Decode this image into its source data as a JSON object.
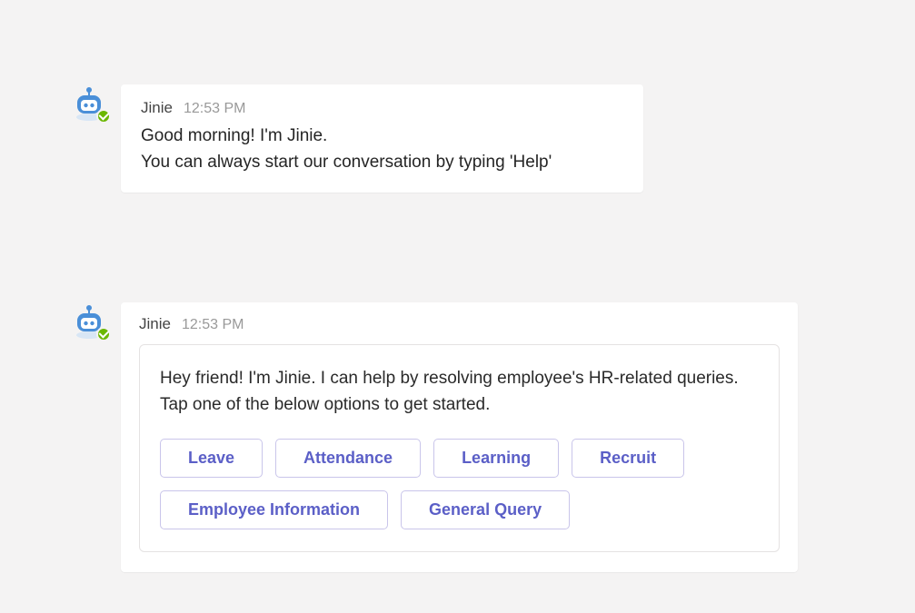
{
  "messages": {
    "m1": {
      "sender": "Jinie",
      "time": "12:53 PM",
      "line1": "Good morning! I'm Jinie.",
      "line2": "You can always start our conversation by typing 'Help'"
    },
    "m2": {
      "sender": "Jinie",
      "time": "12:53 PM",
      "card_text": "Hey friend! I'm Jinie. I can help by resolving employee's HR-related queries. Tap one of the below options to get started.",
      "options": {
        "o1": "Leave",
        "o2": "Attendance",
        "o3": "Learning",
        "o4": "Recruit",
        "o5": "Employee Information",
        "o6": "General Query"
      }
    }
  }
}
